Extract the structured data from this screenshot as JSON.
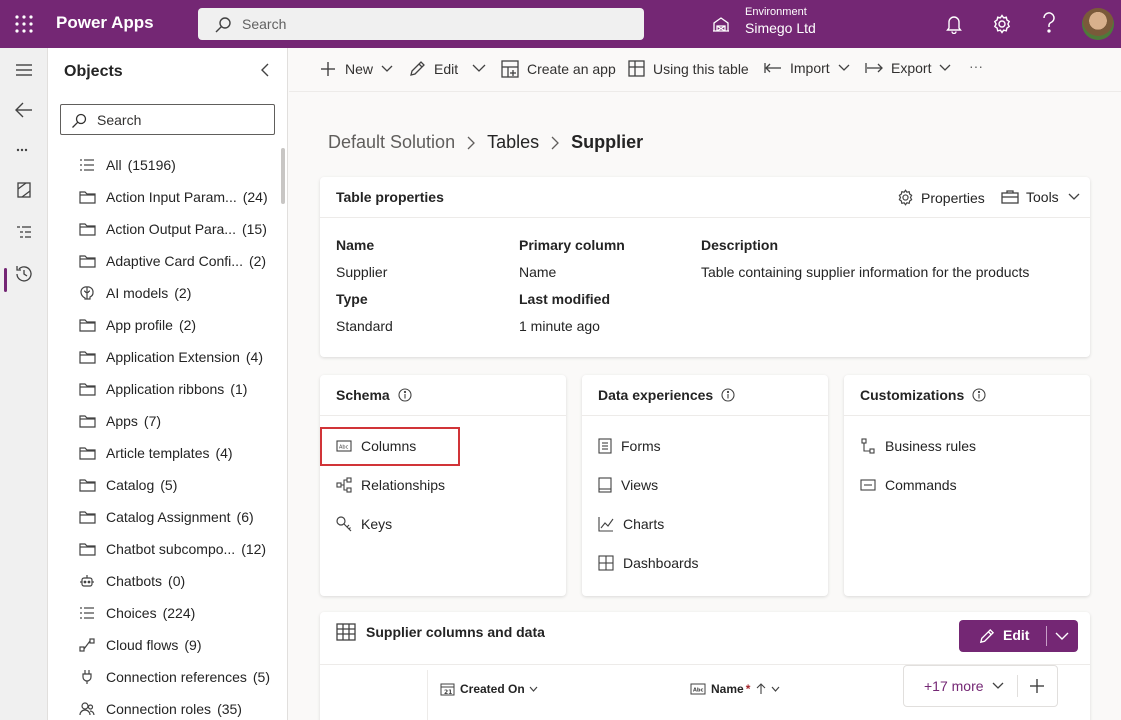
{
  "app": {
    "title": "Power Apps"
  },
  "search": {
    "placeholder": "Search"
  },
  "environment": {
    "label": "Environment",
    "name": "Simego Ltd"
  },
  "objects": {
    "title": "Objects",
    "search_placeholder": "Search",
    "items": [
      {
        "label": "All",
        "count": "(15196)",
        "icon": "list-icon"
      },
      {
        "label": "Action Input Param...",
        "count": "(24)",
        "icon": "folder-icon"
      },
      {
        "label": "Action Output Para...",
        "count": "(15)",
        "icon": "folder-icon"
      },
      {
        "label": "Adaptive Card Confi...",
        "count": "(2)",
        "icon": "folder-icon"
      },
      {
        "label": "AI models",
        "count": "(2)",
        "icon": "brain-icon"
      },
      {
        "label": "App profile",
        "count": "(2)",
        "icon": "folder-icon"
      },
      {
        "label": "Application Extension",
        "count": "(4)",
        "icon": "folder-icon"
      },
      {
        "label": "Application ribbons",
        "count": "(1)",
        "icon": "folder-icon"
      },
      {
        "label": "Apps",
        "count": "(7)",
        "icon": "folder-icon"
      },
      {
        "label": "Article templates",
        "count": "(4)",
        "icon": "folder-icon"
      },
      {
        "label": "Catalog",
        "count": "(5)",
        "icon": "folder-icon"
      },
      {
        "label": "Catalog Assignment",
        "count": "(6)",
        "icon": "folder-icon"
      },
      {
        "label": "Chatbot subcompo...",
        "count": "(12)",
        "icon": "folder-icon"
      },
      {
        "label": "Chatbots",
        "count": "(0)",
        "icon": "bot-icon"
      },
      {
        "label": "Choices",
        "count": "(224)",
        "icon": "list-icon"
      },
      {
        "label": "Cloud flows",
        "count": "(9)",
        "icon": "flow-icon"
      },
      {
        "label": "Connection references",
        "count": "(5)",
        "icon": "plug-icon"
      },
      {
        "label": "Connection roles",
        "count": "(35)",
        "icon": "people-icon"
      }
    ]
  },
  "commands": {
    "new": "New",
    "edit": "Edit",
    "create_app": "Create an app",
    "using_table": "Using this table",
    "import": "Import",
    "export": "Export",
    "more": "···"
  },
  "breadcrumb": {
    "root": "Default Solution",
    "mid": "Tables",
    "current": "Supplier"
  },
  "table_properties": {
    "title": "Table properties",
    "properties_btn": "Properties",
    "tools_btn": "Tools",
    "name_label": "Name",
    "name_value": "Supplier",
    "primary_label": "Primary column",
    "primary_value": "Name",
    "desc_label": "Description",
    "desc_value": "Table containing supplier information for the products",
    "type_label": "Type",
    "type_value": "Standard",
    "modified_label": "Last modified",
    "modified_value": "1 minute ago"
  },
  "schema": {
    "title": "Schema",
    "columns": "Columns",
    "relationships": "Relationships",
    "keys": "Keys"
  },
  "data_experiences": {
    "title": "Data experiences",
    "forms": "Forms",
    "views": "Views",
    "charts": "Charts",
    "dashboards": "Dashboards"
  },
  "customizations": {
    "title": "Customizations",
    "business_rules": "Business rules",
    "commands": "Commands"
  },
  "columns_data": {
    "title": "Supplier columns and data",
    "edit": "Edit",
    "col_created": "Created On",
    "col_name": "Name",
    "required_mark": "*",
    "more": "+17 more"
  },
  "colors": {
    "brand": "#742774",
    "highlight": "#d13438"
  }
}
